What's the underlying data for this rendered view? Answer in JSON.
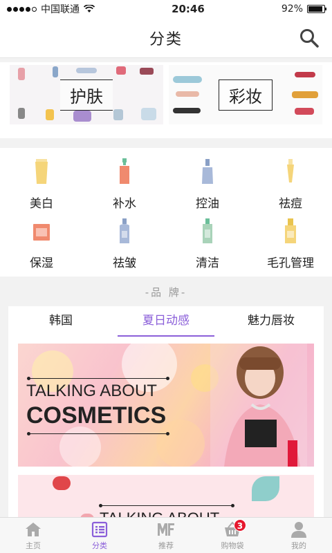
{
  "status_bar": {
    "carrier": "中国联通",
    "time": "20:46",
    "battery": "92%",
    "battery_level": 0.92
  },
  "nav": {
    "title": "分类"
  },
  "banners": [
    {
      "label": "护肤"
    },
    {
      "label": "彩妆"
    }
  ],
  "categories": [
    {
      "label": "美白",
      "icon": "tube-icon",
      "color": "#f5d57a"
    },
    {
      "label": "补水",
      "icon": "spray-bottle-icon",
      "color": "#f08a6e"
    },
    {
      "label": "控油",
      "icon": "lotion-bottle-icon",
      "color": "#a8b9d9"
    },
    {
      "label": "祛痘",
      "icon": "pen-tube-icon",
      "color": "#f5d57a"
    },
    {
      "label": "保湿",
      "icon": "cream-jar-icon",
      "color": "#f08a6e"
    },
    {
      "label": "祛皱",
      "icon": "serum-bottle-icon",
      "color": "#a8b9d9"
    },
    {
      "label": "清洁",
      "icon": "cleanser-bottle-icon",
      "color": "#a9d3b9"
    },
    {
      "label": "毛孔管理",
      "icon": "dropper-bottle-icon",
      "color": "#f5d57a"
    }
  ],
  "brand": {
    "title": "-品 牌-",
    "tabs": [
      {
        "label": "韩国",
        "active": false
      },
      {
        "label": "夏日动感",
        "active": true
      },
      {
        "label": "魅力唇妆",
        "active": false
      }
    ],
    "promo": {
      "line1": "TALKING ABOUT",
      "line2": "COSMETICS"
    },
    "promo2": {
      "line1": "TALKING ABOUT"
    }
  },
  "tab_bar": {
    "items": [
      {
        "label": "主页",
        "icon": "home-icon"
      },
      {
        "label": "分类",
        "icon": "list-icon",
        "active": true
      },
      {
        "label": "推荐",
        "icon": "mf-logo-icon"
      },
      {
        "label": "购物袋",
        "icon": "basket-icon",
        "badge": "3"
      },
      {
        "label": "我的",
        "icon": "user-icon"
      }
    ]
  },
  "colors": {
    "accent": "#8b5fd9",
    "badge": "#e6182e"
  }
}
